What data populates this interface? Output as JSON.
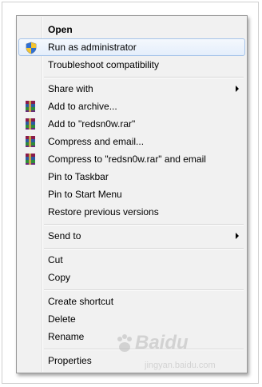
{
  "menu": {
    "open": "Open",
    "run_as_admin": "Run as administrator",
    "troubleshoot": "Troubleshoot compatibility",
    "share_with": "Share with",
    "add_to_archive": "Add to archive...",
    "add_to_rar": "Add to \"redsn0w.rar\"",
    "compress_email": "Compress and email...",
    "compress_rar_email": "Compress to \"redsn0w.rar\" and email",
    "pin_taskbar": "Pin to Taskbar",
    "pin_start": "Pin to Start Menu",
    "restore_versions": "Restore previous versions",
    "send_to": "Send to",
    "cut": "Cut",
    "copy": "Copy",
    "create_shortcut": "Create shortcut",
    "delete": "Delete",
    "rename": "Rename",
    "properties": "Properties"
  },
  "icons": {
    "shield": "uac-shield-icon",
    "winrar": "winrar-archive-icon"
  },
  "watermark": {
    "brand": "Baidu",
    "site": "jingyan.baidu.com"
  },
  "colors": {
    "highlight_border": "#a7c4e9",
    "menu_bg": "#f1f1f1"
  }
}
